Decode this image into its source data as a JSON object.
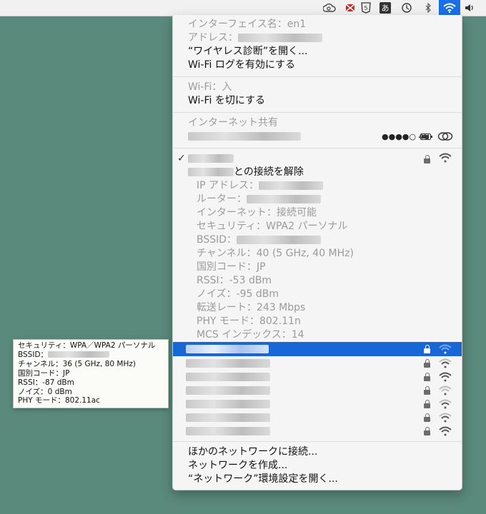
{
  "menubar": {
    "icons": [
      "creative-cloud-icon",
      "mail-flag-icon",
      "html5-icon",
      "input-method-icon",
      "time-machine-icon",
      "bluetooth-icon",
      "wifi-icon",
      "volume-icon"
    ],
    "input_method_label": "あ"
  },
  "menu": {
    "interface_label": "インターフェイス名：en1",
    "address_label": "アドレス：",
    "open_diagnostics": "“ワイヤレス診断”を開く...",
    "enable_wifi_log": "Wi-Fi ログを有効にする",
    "wifi_status": "Wi-Fi：入",
    "wifi_off": "Wi-Fi を切にする",
    "internet_sharing": "インターネット共有",
    "hotspot_signal": "●●●●○ 4G",
    "disconnect_suffix": "との接続を解除",
    "details": [
      "IP アドレス：",
      "ルーター：",
      "インターネット：接続可能",
      "セキュリティ：WPA2 パーソナル",
      "BSSID：",
      "チャンネル：40 (5 GHz, 40 MHz)",
      "国別コード：JP",
      "RSSI：-53 dBm",
      "ノイズ：-95 dBm",
      "転送レート：243 Mbps",
      "PHY モード：802.11n",
      "MCS インデックス：14"
    ],
    "other_network": "ほかのネットワークに接続...",
    "create_network": "ネットワークを作成...",
    "open_prefs": "“ネットワーク”環境設定を開く..."
  },
  "tooltip": {
    "security": "セキュリティ：WPA／WPA2 パーソナル",
    "bssid": "BSSID：",
    "channel": "チャンネル：36 (5 GHz, 80 MHz)",
    "country": "国別コード：JP",
    "rssi": "RSSI：-87 dBm",
    "noise": "ノイズ：0 dBm",
    "phy": "PHY モード：802.11ac"
  },
  "colors": {
    "desktop": "#5a8a7c",
    "highlight": "#1867d6",
    "disabled_text": "#9b9b9b"
  }
}
